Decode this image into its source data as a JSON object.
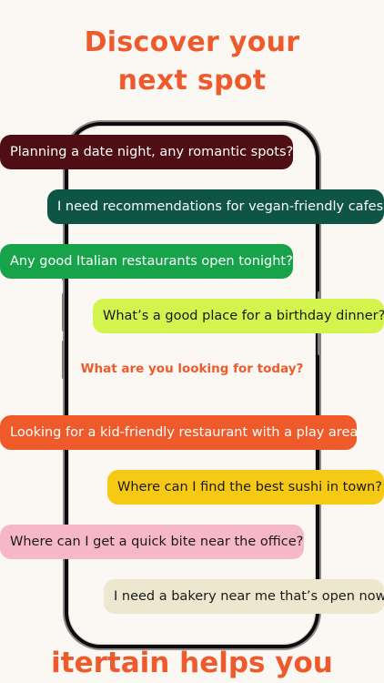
{
  "headline": {
    "line1": "Discover your",
    "line2": "next spot"
  },
  "prompt_question": "What are you looking for today?",
  "footer_text": "itertain helps you",
  "chat_bubbles": [
    {
      "text": "Planning a date night, any romantic spots?",
      "bg": "#4e0e14",
      "fg": "#ffffff"
    },
    {
      "text": "I need recommendations for vegan-friendly cafes",
      "bg": "#0f5546",
      "fg": "#ffffff"
    },
    {
      "text": "Any good Italian restaurants open tonight?",
      "bg": "#17a34a",
      "fg": "#ffffff"
    },
    {
      "text": "What’s a good place for a birthday dinner?",
      "bg": "#d3f34d",
      "fg": "#1a1a1a"
    },
    {
      "text": "Looking for a kid-friendly restaurant with a play area",
      "bg": "#ef5a2b",
      "fg": "#ffffff"
    },
    {
      "text": "Where can I find the best sushi in town?",
      "bg": "#f6c914",
      "fg": "#1a1a1a"
    },
    {
      "text": "Where can I get a quick bite near the office?",
      "bg": "#f6b7c9",
      "fg": "#1a1a1a"
    },
    {
      "text": "I need a bakery near me that’s open now",
      "bg": "#ede7cf",
      "fg": "#1a1a1a"
    }
  ],
  "colors": {
    "accent": "#ee5a2c",
    "background": "#fbf8f3"
  }
}
